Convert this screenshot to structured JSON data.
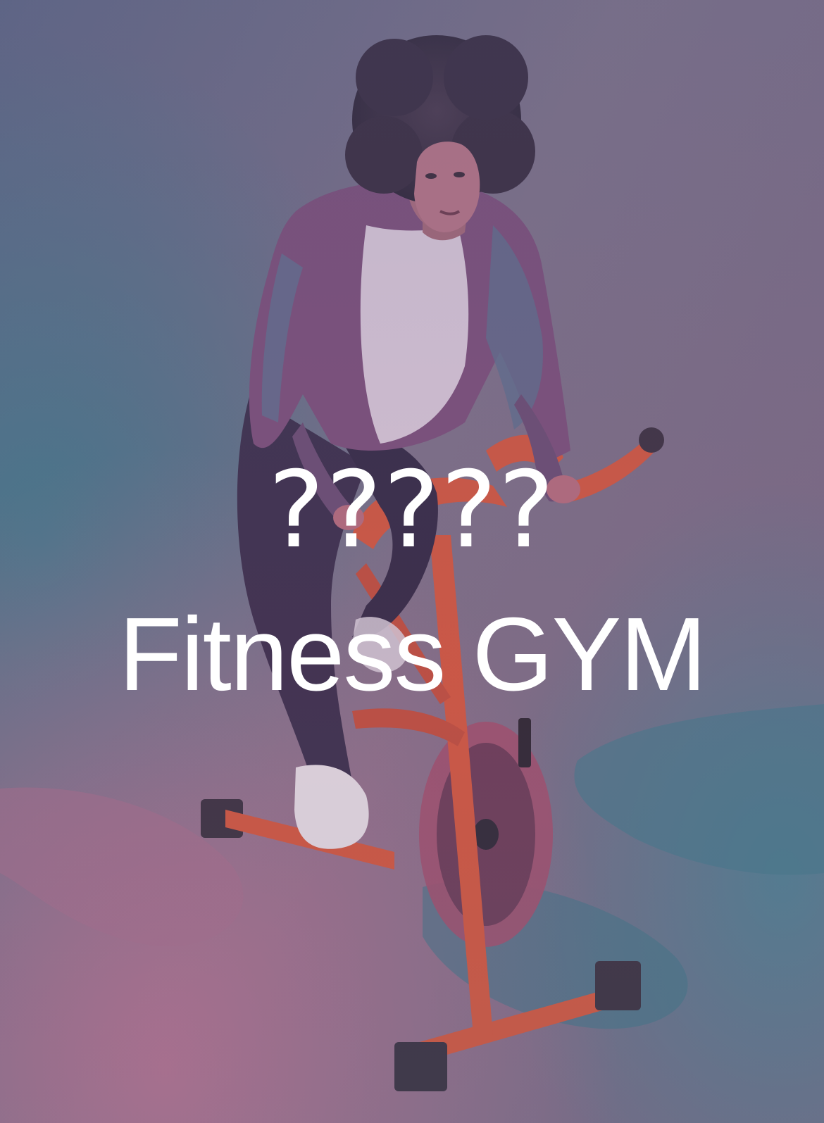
{
  "poster": {
    "headline": "?????",
    "subtitle": "Fitness GYM"
  },
  "colors": {
    "text": "#ffffff",
    "bike_frame": "#d2573f",
    "background_violet": "#6e6680",
    "background_teal": "#4a7689",
    "floor_pink": "#b77a95"
  }
}
